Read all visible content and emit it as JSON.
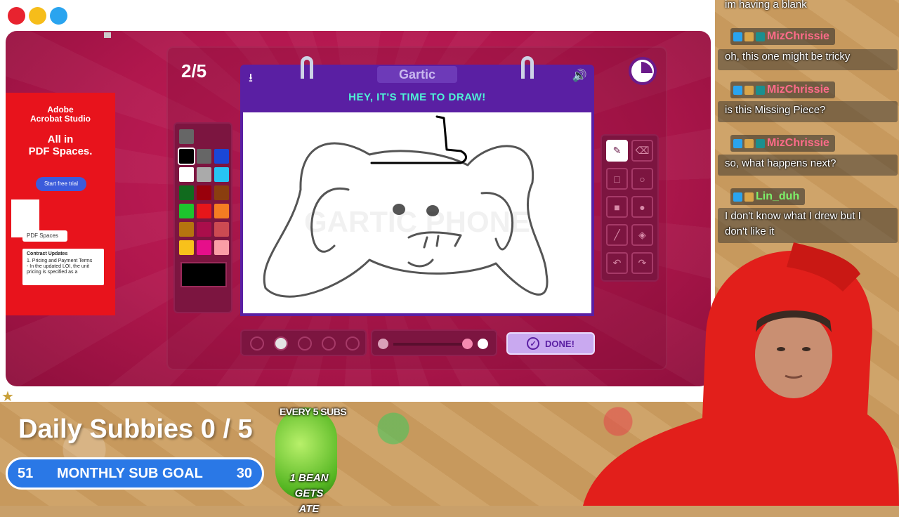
{
  "window": {
    "controls": [
      "close",
      "minimize",
      "maximize"
    ]
  },
  "game": {
    "round": "2/5",
    "logo": "Gartic",
    "header_title": "HEY, IT'S TIME TO DRAW!",
    "download_icon": "download-icon",
    "sound_icon": "speaker-icon",
    "done_label": "DONE!",
    "palette": [
      "#000000",
      "#666666",
      "#1a47d6",
      "#ffffff",
      "#aaaaaa",
      "#27c4f4",
      "#116b1e",
      "#99000b",
      "#8a3e0f",
      "#1dc42d",
      "#e6161a",
      "#f57c22",
      "#b5740f",
      "#aa0e4b",
      "#cc4a52",
      "#f8c11b",
      "#e60f8a",
      "#fa9ea6"
    ],
    "selected_color": "#000000",
    "brush_sizes": 5,
    "selected_brush": 2
  },
  "ad": {
    "brand": "Adobe\nAcrobat Studio",
    "headline": "All in\nPDF Spaces.",
    "cta": "Start free trial",
    "pill": "PDF Spaces",
    "card_title": "Contract Updates",
    "card_line1": "1. Pricing and Payment Terms",
    "card_line2": "- In the updated LOI, the unit",
    "card_line3": "pricing is specified as a"
  },
  "chat": [
    {
      "type": "text",
      "text": "im having a blank"
    },
    {
      "type": "user",
      "name": "MizChrissie",
      "color": "#ff6b8a"
    },
    {
      "type": "text",
      "text": "oh, this one might be tricky"
    },
    {
      "type": "user",
      "name": "MizChrissie",
      "color": "#ff6b8a"
    },
    {
      "type": "text",
      "text": "is this Missing Piece?"
    },
    {
      "type": "user",
      "name": "MizChrissie",
      "color": "#ff6b8a"
    },
    {
      "type": "text",
      "text": "so, what happens next?"
    },
    {
      "type": "user",
      "name": "Lin_duh",
      "color": "#7df06a"
    },
    {
      "type": "text",
      "text": "I don't know what I drew but I"
    },
    {
      "type": "text",
      "text": "don't like it"
    }
  ],
  "overlay": {
    "daily_subbies": "Daily Subbies 0 / 5",
    "goal_left": "51",
    "goal_label": "MONTHLY SUB GOAL",
    "goal_right": "30",
    "bean_top": "EVERY 5 SUBS",
    "bean_bottom": "1 BEAN GETS ATE"
  }
}
